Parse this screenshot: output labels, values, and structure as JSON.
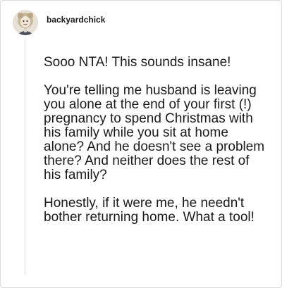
{
  "comment": {
    "username": "backyardchick",
    "avatar_icon": "profile-avatar",
    "paragraphs": [
      "Sooo NTA! This sounds insane!",
      "You're telling me husband is leaving you alone at the end of your first (!) pregnancy to spend Christmas with his family while you sit at home alone? And he doesn't see a problem there? And neither does the rest of his family?",
      "Honestly, if it were me, he needn't bother returning home. What a tool!"
    ]
  },
  "colors": {
    "text": "#1a1a1a",
    "border": "#dcdcdc",
    "background": "#ffffff"
  }
}
